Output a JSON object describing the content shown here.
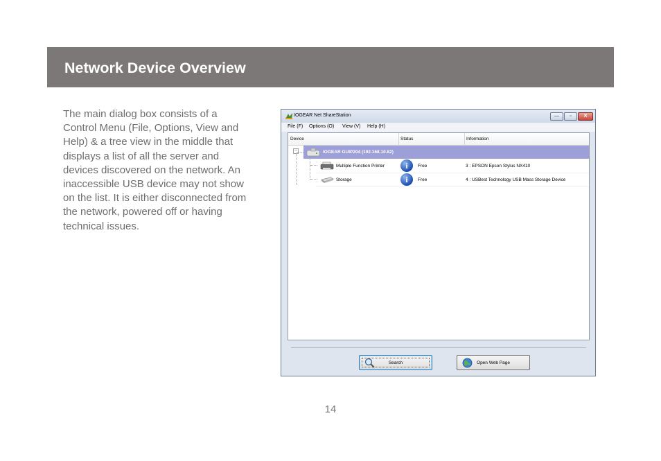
{
  "header": {
    "title": "Network Device Overview"
  },
  "intro": {
    "lines": [
      "The main dialog box consists of a",
      "Control Menu (File, Options, View and",
      "Help) & a tree view in the middle that",
      "displays a list of all the server and",
      "devices discovered on the network. An",
      "inaccessible USB device may not show",
      "on the list. It is either disconnected from",
      "the network, powered off or having",
      "technical issues."
    ]
  },
  "window": {
    "title": "IOGEAR Net ShareStation",
    "controls": {
      "minimize": "—",
      "maximize": "▫",
      "close": "✕"
    },
    "menu": [
      "File (F)",
      "Options (O)",
      "View (V)",
      "Help (H)"
    ],
    "columns": [
      "Device",
      "Status",
      "Information"
    ],
    "server": {
      "label": "IOGEAR GUIP204  (192.168.10.82)",
      "expander": "−"
    },
    "devices": [
      {
        "name": "Multiple Function Printer",
        "status": "Free",
        "info": "3 : EPSON Epson Stylus NX410",
        "icon": "printer-icon"
      },
      {
        "name": "Storage",
        "status": "Free",
        "info": "4 : USBest Technology USB Mass Storage Device",
        "icon": "storage-icon"
      }
    ],
    "buttons": {
      "search": "Search",
      "open_web_page": "Open Web Page"
    },
    "info_glyph": "i"
  },
  "page": {
    "number": "14"
  },
  "colors": {
    "banner": "#7c7878",
    "body_text": "#6d6d6d",
    "server_row": "#9c9fd8",
    "info_icon": "#1c4fb0"
  }
}
